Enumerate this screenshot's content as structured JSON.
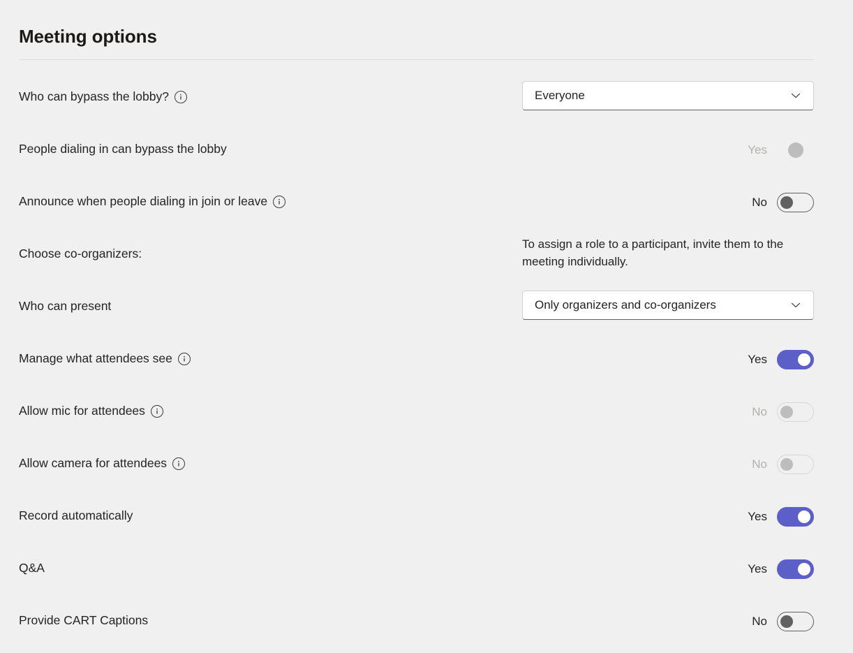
{
  "header": {
    "title": "Meeting options"
  },
  "options": [
    {
      "id": "who-can-bypass-lobby",
      "label": "Who can bypass the lobby?",
      "has_info": true,
      "control": "dropdown",
      "value": "Everyone",
      "icon": "chevron-down-icon"
    },
    {
      "id": "people-dialing-in-can-bypass-lobby",
      "label": "People dialing in can bypass the lobby",
      "has_info": false,
      "control": "switch-readonly",
      "state_label": "Yes",
      "checked": true,
      "disabled": true
    },
    {
      "id": "announce-when-people-dialing-in-join-or-leave",
      "label": "Announce when people dialing in join or leave",
      "has_info": true,
      "control": "switch",
      "state_label": "No",
      "checked": false,
      "disabled": false
    },
    {
      "id": "choose-co-organizers",
      "label": "Choose co-organizers:",
      "has_info": false,
      "control": "helper-text",
      "helper_text": "To assign a role to a participant, invite them to the meeting individually."
    },
    {
      "id": "who-can-present",
      "label": "Who can present",
      "has_info": false,
      "control": "dropdown",
      "value": "Only organizers and co-organizers",
      "icon": "chevron-down-icon"
    },
    {
      "id": "manage-what-attendees-see",
      "label": "Manage what attendees see",
      "has_info": true,
      "control": "switch",
      "state_label": "Yes",
      "checked": true,
      "disabled": false
    },
    {
      "id": "allow-mic-for-attendees",
      "label": "Allow mic for attendees",
      "has_info": true,
      "control": "switch",
      "state_label": "No",
      "checked": false,
      "disabled": true
    },
    {
      "id": "allow-camera-for-attendees",
      "label": "Allow camera for attendees",
      "has_info": true,
      "control": "switch",
      "state_label": "No",
      "checked": false,
      "disabled": true
    },
    {
      "id": "record-automatically",
      "label": "Record automatically",
      "has_info": false,
      "control": "switch",
      "state_label": "Yes",
      "checked": true,
      "disabled": false
    },
    {
      "id": "q-and-a",
      "label": "Q&A",
      "has_info": false,
      "control": "switch",
      "state_label": "Yes",
      "checked": true,
      "disabled": false
    },
    {
      "id": "provide-cart-captions",
      "label": "Provide CART Captions",
      "has_info": false,
      "control": "switch",
      "state_label": "No",
      "checked": false,
      "disabled": false
    }
  ],
  "colors": {
    "background": "#f0f0f0",
    "accent": "#5b5fc7",
    "text": "#242424",
    "disabled_text": "#b3b0ad",
    "divider": "#dcdcdc",
    "field_background": "#ffffff",
    "field_border": "#d1d1d1",
    "field_underline": "#616161"
  }
}
